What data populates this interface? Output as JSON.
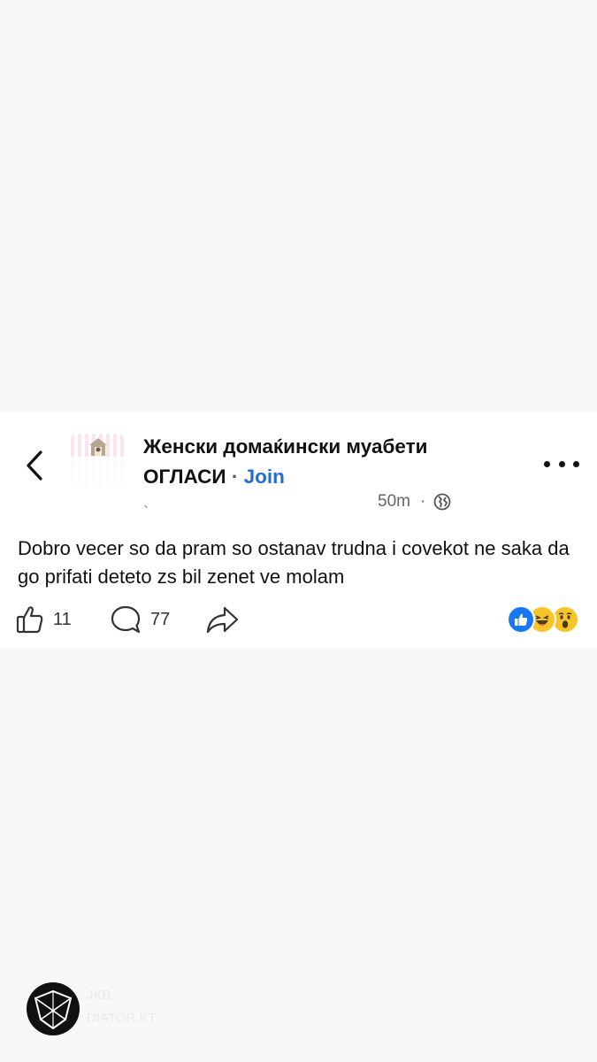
{
  "post": {
    "group_name_line1": "Женски домаќински муабети",
    "group_name_line2": "ОГЛАСИ",
    "separator": " · ",
    "join_label": "Join",
    "author": "ˎ",
    "time": "50m",
    "meta_dot": "·",
    "privacy_icon": "globe-icon",
    "text": "Dobro vecer so da pram so ostanav trudna i covekot ne saka da go prifati deteto zs bil zenet ve molam",
    "likes_count": "11",
    "comments_count": "77",
    "reactions": [
      "like",
      "haha",
      "wow"
    ]
  },
  "watermark": {
    "line1": "JKB",
    "line2": "DIATOR.KT"
  },
  "colors": {
    "join_link": "#1f6fd1",
    "like_reaction": "#1877f2",
    "emoji_yellow": "#f7c429",
    "card_background": "#ffffff",
    "page_background": "#f8f8f8"
  }
}
